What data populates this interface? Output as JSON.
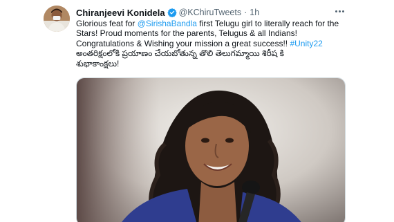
{
  "tweet": {
    "author_name": "Chiranjeevi Konidela",
    "handle": "@KChiruTweets",
    "separator": "·",
    "time": "1h",
    "lines": [
      {
        "pre": "Glorious feat for ",
        "link": "@SirishaBandla",
        "post": " first Telugu girl to literally reach for the"
      },
      {
        "pre": "Stars! Proud moments for the parents, Telugus & all Indians!",
        "link": "",
        "post": ""
      },
      {
        "pre": "Congratulations & Wishing your mission a great success!! ",
        "link": "#Unity22",
        "post": ""
      },
      {
        "pre": "అంతరిక్షంలోకి ప్రయాణం చేయబోతున్న తొలి తెలుగమ్మాయి శిరీష కి",
        "link": "",
        "post": ""
      },
      {
        "pre": "శుభాకాంక్షలు!",
        "link": "",
        "post": ""
      }
    ]
  },
  "icons": {
    "verified": "verified-badge-icon",
    "more": "more-options-icon"
  },
  "colors": {
    "link": "#1d9bf0",
    "secondary_text": "#536471",
    "verified": "#1d9bf0"
  }
}
